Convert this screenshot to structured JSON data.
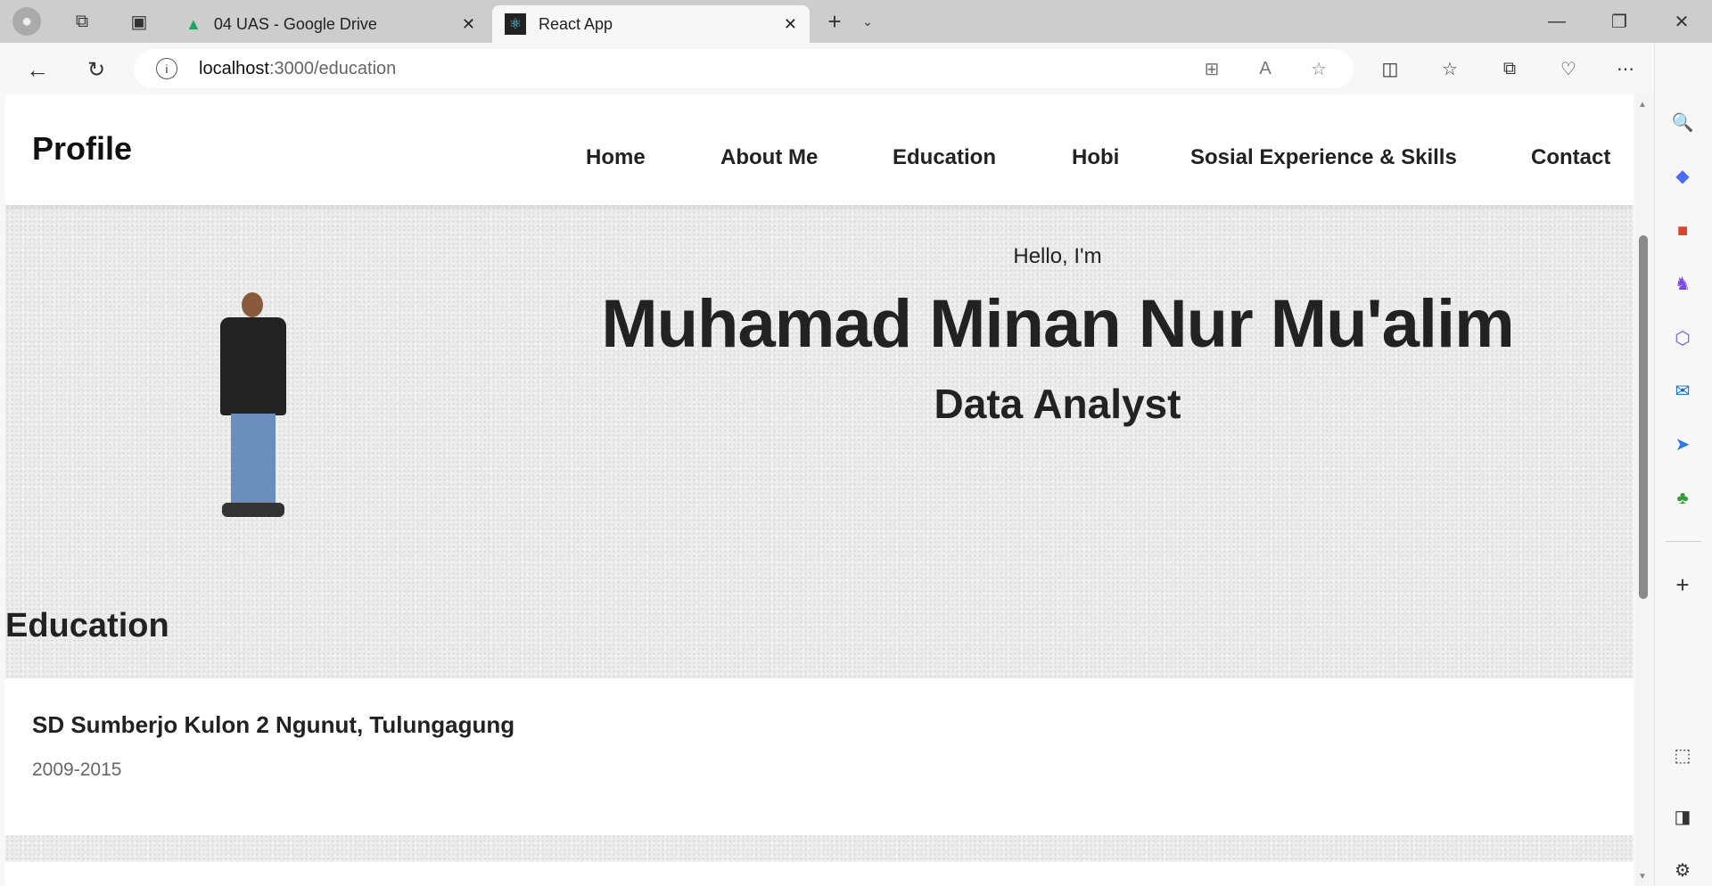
{
  "browser": {
    "tabs": [
      {
        "title": "04 UAS - Google Drive"
      },
      {
        "title": "React App"
      }
    ],
    "url_host": "localhost",
    "url_path": ":3000/education"
  },
  "header": {
    "brand": "Profile",
    "nav": [
      "Home",
      "About Me",
      "Education",
      "Hobi",
      "Sosial Experience & Skills",
      "Contact"
    ]
  },
  "hero": {
    "greeting": "Hello, I'm",
    "name": "Muhamad Minan Nur Mu'alim",
    "role": "Data Analyst"
  },
  "education": {
    "heading": "Education",
    "items": [
      {
        "school": "SD Sumberjo Kulon 2 Ngunut, Tulungagung",
        "years": "2009-2015"
      }
    ]
  }
}
